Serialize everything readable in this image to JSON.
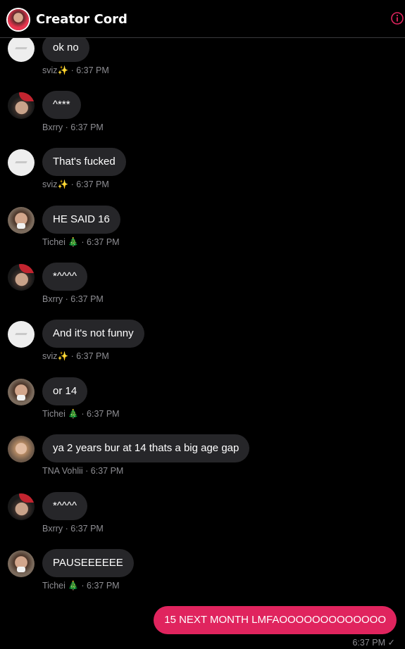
{
  "header": {
    "title": "Creator Cord"
  },
  "messages": [
    {
      "author": "sviz✨",
      "time": "6:37 PM",
      "text": "ok no",
      "avatar": "sviz"
    },
    {
      "author": "Bxrry",
      "time": "6:37 PM",
      "text": "^***",
      "avatar": "bxrry"
    },
    {
      "author": "sviz✨",
      "time": "6:37 PM",
      "text": "That's fucked",
      "avatar": "sviz"
    },
    {
      "author": "Tichei 🎄",
      "time": "6:37 PM",
      "text": "HE SAID 16",
      "avatar": "tichei"
    },
    {
      "author": "Bxrry",
      "time": "6:37 PM",
      "text": "*^^^^",
      "avatar": "bxrry"
    },
    {
      "author": "sviz✨",
      "time": "6:37 PM",
      "text": "And it's not funny",
      "avatar": "sviz"
    },
    {
      "author": "Tichei 🎄",
      "time": "6:37 PM",
      "text": "or 14",
      "avatar": "tichei"
    },
    {
      "author": "TNA Vohlii",
      "time": "6:37 PM",
      "text": "ya 2 years bur at 14 thats a big age gap",
      "avatar": "tna"
    },
    {
      "author": "Bxrry",
      "time": "6:37 PM",
      "text": "*^^^^",
      "avatar": "bxrry"
    },
    {
      "author": "Tichei 🎄",
      "time": "6:37 PM",
      "text": "PAUSEEEEEE",
      "avatar": "tichei"
    }
  ],
  "outgoing": {
    "text": "15 NEXT MONTH LMFAOOOOOOOOOOOOO",
    "time": "6:37 PM",
    "status": "✓"
  },
  "colors": {
    "accent": "#e0245e",
    "bubble_in": "#262629",
    "meta": "#8e8e93",
    "background": "#000000"
  }
}
